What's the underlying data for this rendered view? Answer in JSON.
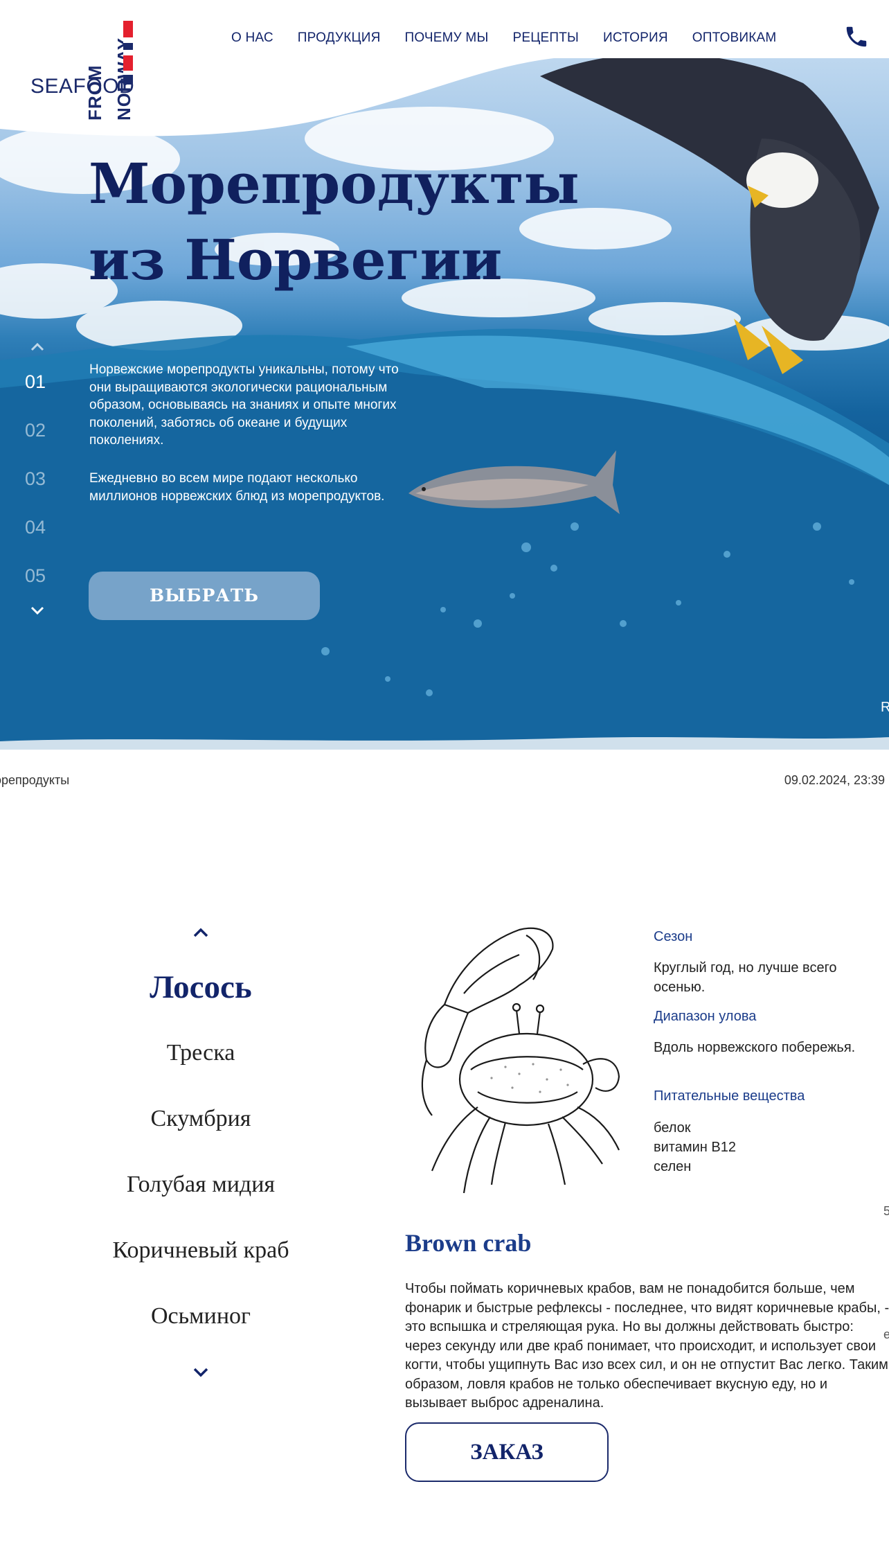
{
  "logo": {
    "line1": "FROM",
    "line2": "NORWAY",
    "line3": "SEAFOOD"
  },
  "nav": {
    "items": [
      "О НАС",
      "ПРОДУКЦИЯ",
      "ПОЧЕМУ МЫ",
      "РЕЦЕПТЫ",
      "ИСТОРИЯ",
      "ОПТОВИКАМ"
    ],
    "phone_icon": "phone-icon"
  },
  "hero": {
    "title_line1": "Морепродукты",
    "title_line2": "из Норвегии",
    "paragraph1": "Норвежские морепродукты уникальны, потому что они выращиваются экологически рациональным образом, основываясь на знаниях и опыте многих поколений, заботясь об океане и будущих поколениях.",
    "paragraph2": "Ежедневно во всем мире подают несколько миллионов норвежских блюд из морепродуктов.",
    "slides": [
      "01",
      "02",
      "03",
      "04",
      "05"
    ],
    "active_slide": "01",
    "button": "ВЫБРАТЬ",
    "edge_letter": "R"
  },
  "print_bar": {
    "left": "орепродукты",
    "right": "09.02.2024, 23:39"
  },
  "products": {
    "list": [
      "Лосось",
      "Треска",
      "Скумбрия",
      "Голубая мидия",
      "Коричневый краб",
      "Осьминог"
    ],
    "active": "Лосось",
    "season_label": "Сезон",
    "season_value": "Круглый год, но лучше всего осенью.",
    "range_label": "Диапазон улова",
    "range_value": "Вдоль норвежского побережья.",
    "nutrients_label": "Питательные вещества",
    "nutrients": [
      "белок",
      "витамин B12",
      "селен"
    ],
    "name": "Brown crab",
    "description": "Чтобы поймать коричневых крабов, вам не понадобится больше, чем фонарик и быстрые рефлексы - последнее, что видят коричневые крабы, - это вспышка и стреляющая рука. Но вы должны действовать быстро: через секунду или две краб понимает, что происходит, и использует свои когти, чтобы ущипнуть Вас изо всех сил, и он не отпустит Вас легко. Таким образом, ловля крабов не только обеспечивает вкусную еду, но и вызывает выброс адреналина.",
    "order_button": "ЗАКАЗ",
    "edge_marks": [
      "5",
      "е"
    ]
  },
  "colors": {
    "brand_navy": "#12246a",
    "label_blue": "#1b3c8a",
    "flag_red": "#e4202e"
  }
}
